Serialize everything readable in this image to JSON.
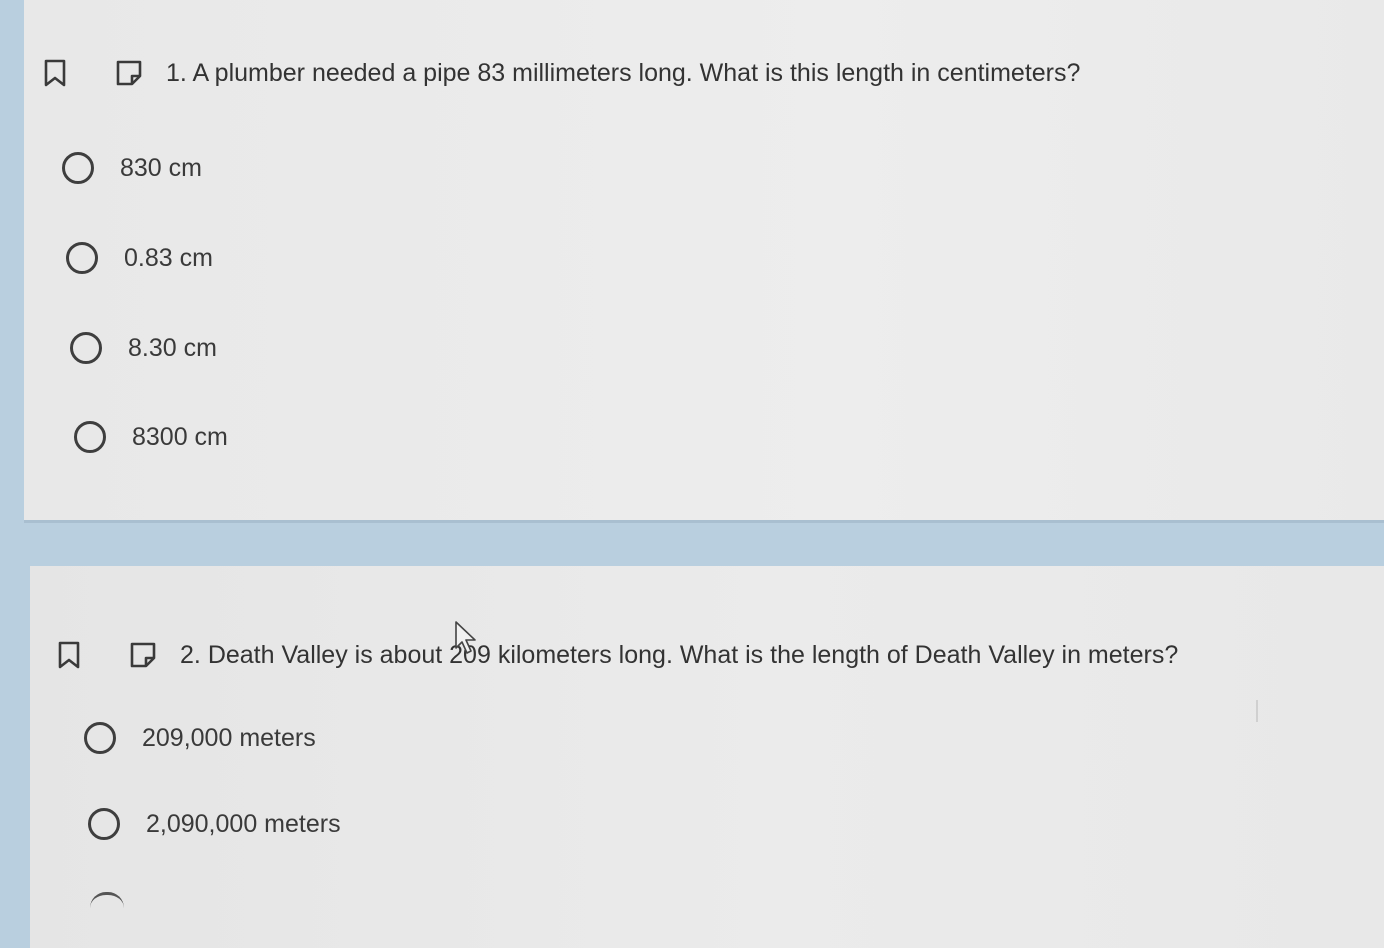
{
  "questions": [
    {
      "number": "1.",
      "text": "A plumber needed a pipe 83 millimeters long. What is this length in centimeters?",
      "options": [
        "830 cm",
        "0.83 cm",
        "8.30 cm",
        "8300 cm"
      ]
    },
    {
      "number": "2.",
      "text": "Death Valley is about 209 kilometers long. What is the length of Death Valley in meters?",
      "options": [
        "209,000 meters",
        "2,090,000 meters"
      ]
    }
  ],
  "icons": {
    "bookmark": "bookmark-icon",
    "note": "note-icon",
    "radio": "radio-button",
    "cursor": "mouse-cursor-icon"
  },
  "colors": {
    "background": "#b9cfdf",
    "card": "#ececec",
    "text": "#333333",
    "radio_border": "#3e3e3e"
  }
}
